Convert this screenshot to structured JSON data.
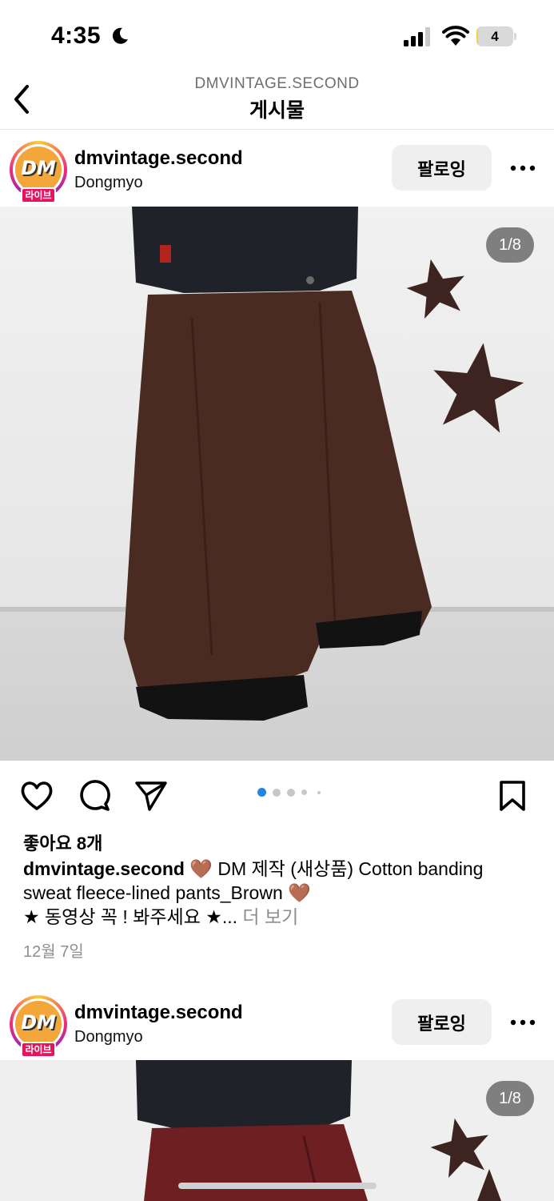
{
  "status_bar": {
    "time": "4:35",
    "battery_level": "4",
    "battery_fraction": 0.04
  },
  "nav": {
    "subtitle": "DMVINTAGE.SECOND",
    "title": "게시물"
  },
  "posts": [
    {
      "username": "dmvintage.second",
      "location": "Dongmyo",
      "live_badge": "라이브",
      "avatar_text": "DM",
      "follow_label": "팔로잉",
      "image_counter": "1/8",
      "pants_color": "#4a2b22",
      "likes": "좋아요 8개",
      "caption_user": "dmvintage.second",
      "caption_line1": " 🤎 DM 제작 (새상품) Cotton banding sweat fleece-lined pants_Brown 🤎",
      "caption_line2": "★ 동영상 꼭 ! 봐주세요 ★...",
      "more_label": " 더 보기",
      "date": "12월 7일"
    },
    {
      "username": "dmvintage.second",
      "location": "Dongmyo",
      "live_badge": "라이브",
      "avatar_text": "DM",
      "follow_label": "팔로잉",
      "image_counter": "1/8",
      "pants_color": "#6e1f22"
    }
  ],
  "icons": {
    "back": "chevron-left-icon",
    "more": "more-horizontal-icon",
    "like": "heart-icon",
    "comment": "comment-icon",
    "share": "paper-plane-icon",
    "save": "bookmark-icon"
  },
  "carousel": {
    "total_dots": 5,
    "active_index": 0
  }
}
